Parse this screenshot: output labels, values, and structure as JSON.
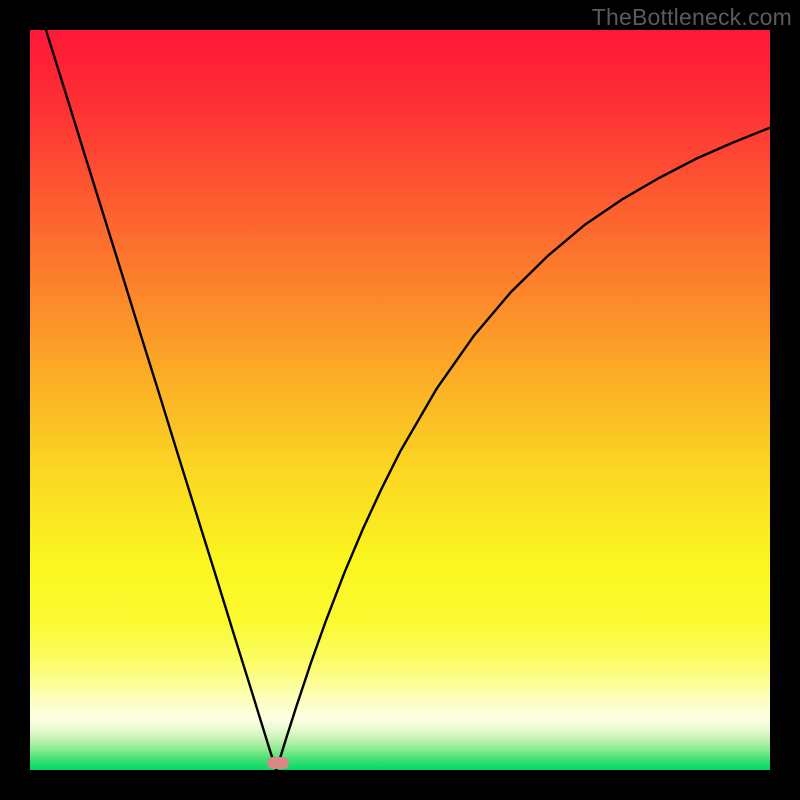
{
  "watermark": "TheBottleneck.com",
  "chart_data": {
    "type": "line",
    "title": "",
    "xlabel": "",
    "ylabel": "",
    "xlim": [
      0,
      1
    ],
    "ylim": [
      0,
      1
    ],
    "series": [
      {
        "name": "curve",
        "x": [
          0.0,
          0.025,
          0.05,
          0.075,
          0.1,
          0.125,
          0.15,
          0.175,
          0.2,
          0.225,
          0.25,
          0.275,
          0.3,
          0.325,
          0.333,
          0.345,
          0.36,
          0.38,
          0.4,
          0.425,
          0.45,
          0.475,
          0.5,
          0.55,
          0.6,
          0.65,
          0.7,
          0.75,
          0.8,
          0.85,
          0.9,
          0.95,
          1.0
        ],
        "y": [
          1.07,
          0.989,
          0.909,
          0.828,
          0.748,
          0.668,
          0.587,
          0.507,
          0.426,
          0.346,
          0.266,
          0.185,
          0.105,
          0.024,
          0.0,
          0.039,
          0.086,
          0.146,
          0.202,
          0.267,
          0.326,
          0.38,
          0.43,
          0.516,
          0.587,
          0.646,
          0.695,
          0.737,
          0.771,
          0.8,
          0.826,
          0.848,
          0.868
        ]
      }
    ],
    "marker": {
      "x": 0.335,
      "y": 0.01,
      "color": "#db8785"
    },
    "gradient_stops": [
      {
        "offset": 0.0,
        "color": "#fe1838"
      },
      {
        "offset": 0.1,
        "color": "#fe2f35"
      },
      {
        "offset": 0.22,
        "color": "#fd5830"
      },
      {
        "offset": 0.35,
        "color": "#fc842b"
      },
      {
        "offset": 0.48,
        "color": "#fbb126"
      },
      {
        "offset": 0.6,
        "color": "#fbd822"
      },
      {
        "offset": 0.72,
        "color": "#faf61f"
      },
      {
        "offset": 0.8,
        "color": "#fbfa32"
      },
      {
        "offset": 0.86,
        "color": "#fbfd6e"
      },
      {
        "offset": 0.905,
        "color": "#fdfebd"
      },
      {
        "offset": 0.93,
        "color": "#feffe3"
      },
      {
        "offset": 0.945,
        "color": "#e7fad2"
      },
      {
        "offset": 0.96,
        "color": "#bef2ae"
      },
      {
        "offset": 0.975,
        "color": "#7ce88b"
      },
      {
        "offset": 0.988,
        "color": "#35df6f"
      },
      {
        "offset": 1.0,
        "color": "#02da68"
      }
    ]
  }
}
